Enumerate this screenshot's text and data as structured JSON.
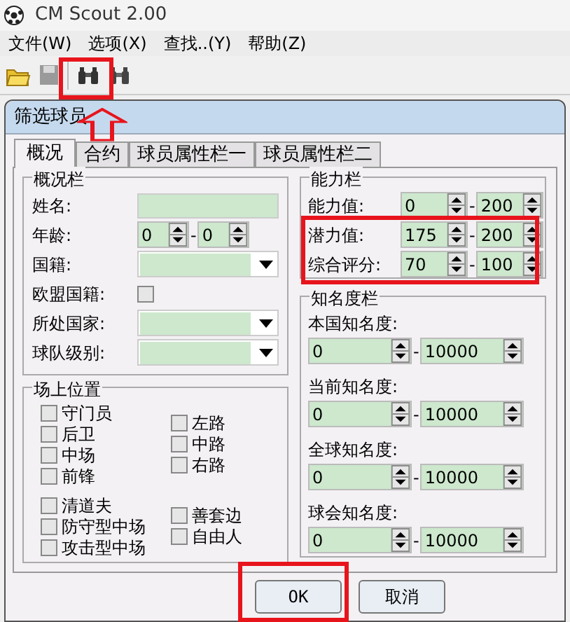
{
  "window": {
    "title": "CM Scout 2.00"
  },
  "menu": [
    "文件(W)",
    "选项(X)",
    "查找..(Y)",
    "帮助(Z)"
  ],
  "dialog": {
    "title": "筛选球员",
    "tabs": [
      {
        "label": "概况",
        "selected": true
      },
      {
        "label": "合约",
        "selected": false
      },
      {
        "label": "球员属性栏一",
        "selected": false
      },
      {
        "label": "球员属性栏二",
        "selected": false
      }
    ],
    "overview": {
      "title": "概况栏",
      "fields": [
        {
          "kind": "text",
          "label": "姓名:"
        },
        {
          "kind": "range",
          "label": "年龄:",
          "from": "0",
          "separator": "-",
          "to": "0"
        },
        {
          "kind": "dropdown",
          "label": "国籍:"
        },
        {
          "kind": "checkbox",
          "label": "欧盟国籍:",
          "checked": false
        },
        {
          "kind": "dropdown",
          "label": "所处国家:"
        },
        {
          "kind": "dropdown",
          "label": "球队级别:"
        }
      ]
    },
    "positions": {
      "title": "场上位置",
      "groups": [
        {
          "left": [
            {
              "label": "守门员",
              "checked": false
            },
            {
              "label": "后卫",
              "checked": false
            },
            {
              "label": "中场",
              "checked": false
            },
            {
              "label": "前锋",
              "checked": false
            }
          ],
          "right": [
            {
              "label": "左路",
              "checked": false
            },
            {
              "label": "中路",
              "checked": false
            },
            {
              "label": "右路",
              "checked": false
            }
          ]
        },
        {
          "left": [
            {
              "label": "清道夫",
              "checked": false
            },
            {
              "label": "防守型中场",
              "checked": false
            },
            {
              "label": "攻击型中场",
              "checked": false
            }
          ],
          "right": [
            {
              "label": "善套边",
              "checked": false
            },
            {
              "label": "自由人",
              "checked": false
            }
          ]
        }
      ]
    },
    "ability": {
      "title": "能力栏",
      "rows": [
        {
          "label": "能力值:",
          "from": "0",
          "separator": "-",
          "to": "200"
        },
        {
          "label": "潜力值:",
          "from": "175",
          "separator": "-",
          "to": "200"
        },
        {
          "label": "综合评分:",
          "from": "70",
          "separator": "-",
          "to": "100"
        }
      ]
    },
    "fame": {
      "title": "知名度栏",
      "rows": [
        {
          "label": "本国知名度:",
          "from": "0",
          "separator": "-",
          "to": "10000"
        },
        {
          "label": "当前知名度:",
          "from": "0",
          "separator": "-",
          "to": "10000"
        },
        {
          "label": "全球知名度:",
          "from": "0",
          "separator": "-",
          "to": "10000"
        },
        {
          "label": "球会知名度:",
          "from": "0",
          "separator": "-",
          "to": "10000"
        }
      ]
    },
    "buttons": [
      "OK",
      "取消"
    ]
  }
}
